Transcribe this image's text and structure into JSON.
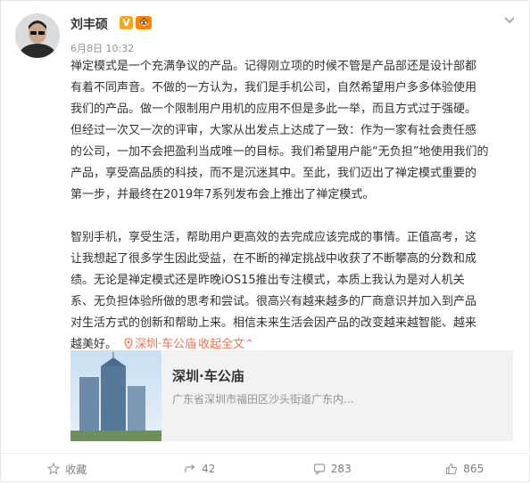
{
  "author": {
    "name": "刘丰硕",
    "verified_badge": "V",
    "vip_badge": "🐯",
    "time": "6月8日 10:32"
  },
  "post": {
    "paragraph1_lines": [
      "禅定模式是一个充满争议的产品。记得刚立项的时候不管是产品部还是设计部都",
      "有着不同声音。不做的一方认为，我们是手机公司，自然希望用户多多体验使用",
      "我们的产品。做一个限制用户用机的应用不但是多此一举，而且方式过于强硬。",
      "但经过一次又一次的评审，大家从出发点上达成了一致：作为一家有社会责任感",
      "的公司，一加不会把盈利当成唯一的目标。我们希望用户能“无负担”地使用我们的",
      "产品，享受高品质的科技，而不是沉迷其中。至此，我们迈出了禅定模式重要的",
      "第一步，并最终在2019年7系列发布会上推出了禅定模式。"
    ],
    "paragraph2_lines": [
      "智别手机，享受生活，帮助用户更高效的去完成应该完成的事情。正值高考，这",
      "让我想起了很多学生因此受益，在不断的禅定挑战中收获了不断攀高的分数和成",
      "绩。无论是禅定模式还是昨晚iOS15推出专注模式，本质上我认为是对人机关",
      "系、无负担体验所做的思考和尝试。很高兴有越来越多的厂商意识并加入到产品",
      "对生活方式的创新和帮助上来。相信未来生活会因产品的改变越来越智能、越来"
    ],
    "last_line": "越美好。",
    "location_link": "深圳·车公庙",
    "collapse_label": "收起全文",
    "collapse_chevron": "⌃"
  },
  "location_card": {
    "title": "深圳·车公庙",
    "address": "广东省深圳市福田区沙头街道广东内..."
  },
  "actions": {
    "favorite_label": "收藏",
    "forward_count": "42",
    "comment_count": "283",
    "like_count": "865"
  },
  "icons": {
    "more": "chevron-down-icon",
    "pin": "location-pin-icon",
    "favorite": "star-icon",
    "forward": "forward-icon",
    "comment": "comment-icon",
    "like": "thumbs-up-icon"
  },
  "colors": {
    "link": "#eb7350",
    "muted": "#939393"
  }
}
